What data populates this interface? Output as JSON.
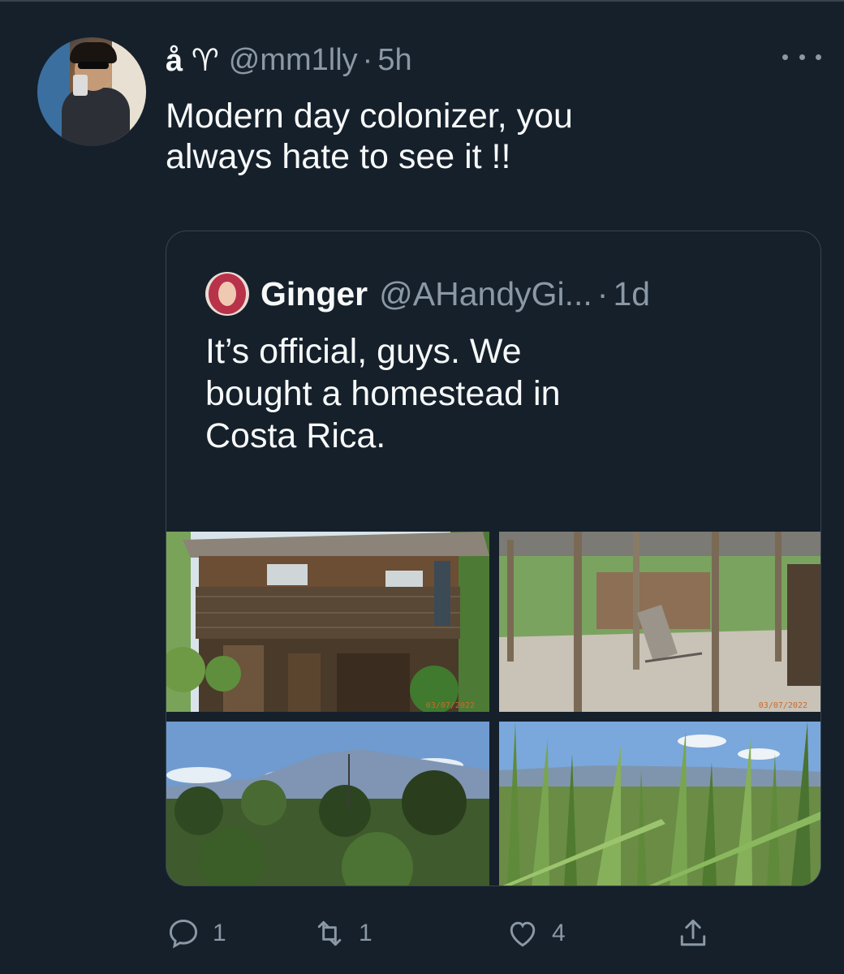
{
  "tweet": {
    "display_name": "å ♈",
    "handle": "@mm1lly",
    "dot": "·",
    "time": "5h",
    "text_line1": "Modern day colonizer, you",
    "text_line2": "always hate to see it !!"
  },
  "quote": {
    "display_name": "Ginger",
    "handle": "@AHandyGi...",
    "dot": "·",
    "time": "1d",
    "text_line1": "It’s official, guys. We",
    "text_line2": "bought a homestead in",
    "text_line3": "Costa Rica.",
    "images": [
      {
        "subject": "wooden two-story house",
        "date_stamp": "03/07/2022"
      },
      {
        "subject": "covered open-air porch",
        "date_stamp": "03/07/2022"
      },
      {
        "subject": "forest and mountains"
      },
      {
        "subject": "tall grass field and mountains"
      }
    ]
  },
  "actions": {
    "reply_count": "1",
    "retweet_count": "1",
    "like_count": "4"
  },
  "colors": {
    "background": "#15202b",
    "text_primary": "#f7f9f9",
    "text_secondary": "#8b98a5",
    "border": "#38444d"
  }
}
